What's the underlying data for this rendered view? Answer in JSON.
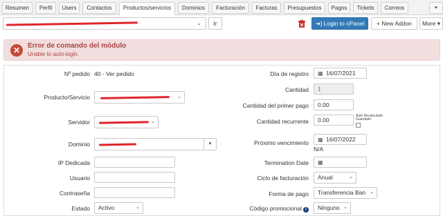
{
  "tabs": [
    {
      "label": "Resumen"
    },
    {
      "label": "Perfil"
    },
    {
      "label": "Users"
    },
    {
      "label": "Contactos"
    },
    {
      "label": "Productos/servicios"
    },
    {
      "label": "Dominios"
    },
    {
      "label": "Facturación"
    },
    {
      "label": "Facturas"
    },
    {
      "label": "Presupuestos"
    },
    {
      "label": "Pagos"
    },
    {
      "label": "Tickets"
    },
    {
      "label": "Correos"
    }
  ],
  "toolbar": {
    "go_label": "Ir",
    "login_label": "Login to cPanel",
    "new_addon_label": "+ New Addon",
    "more_label": "More ▾"
  },
  "alert": {
    "title": "Error de comando del módulo",
    "message": "Unable to auto-login."
  },
  "form": {
    "order_id_label": "Nº pedido",
    "order_id_value": "40 - Ver pedido",
    "product_label": "Producto/Servicio",
    "server_label": "Servidor",
    "domain_label": "Dominio",
    "dedicated_ip_label": "IP Dedicada",
    "username_label": "Usuario",
    "password_label": "Contraseña",
    "status_label": "Estado",
    "status_value": "Activo",
    "registration_date_label": "Día de registro",
    "registration_date_value": "16/07/2021",
    "quantity_label": "Cantidad",
    "quantity_value": "1",
    "first_payment_label": "Cantidad del primer pago",
    "first_payment_value": "0.00",
    "recurring_label": "Cantidad recurrente",
    "recurring_value": "0.00",
    "auto_recalc_label_1": "Auto Recalculado",
    "auto_recalc_label_2": "Guardado",
    "next_due_label": "Próximo vencimiento",
    "next_due_value": "16/07/2022",
    "next_due_note": "N/A",
    "termination_label": "Termination Date",
    "billing_cycle_label": "Ciclo de facturación",
    "billing_cycle_value": "Anual",
    "payment_method_label": "Forma de pago",
    "payment_method_value": "Transferencia Ban",
    "promo_label": "Código promocional",
    "promo_value": "Ninguno"
  },
  "colors": {
    "primary": "#337ab7",
    "alert_bg": "#f2dede",
    "alert_text": "#a94442",
    "redaction": "#e0242a"
  }
}
